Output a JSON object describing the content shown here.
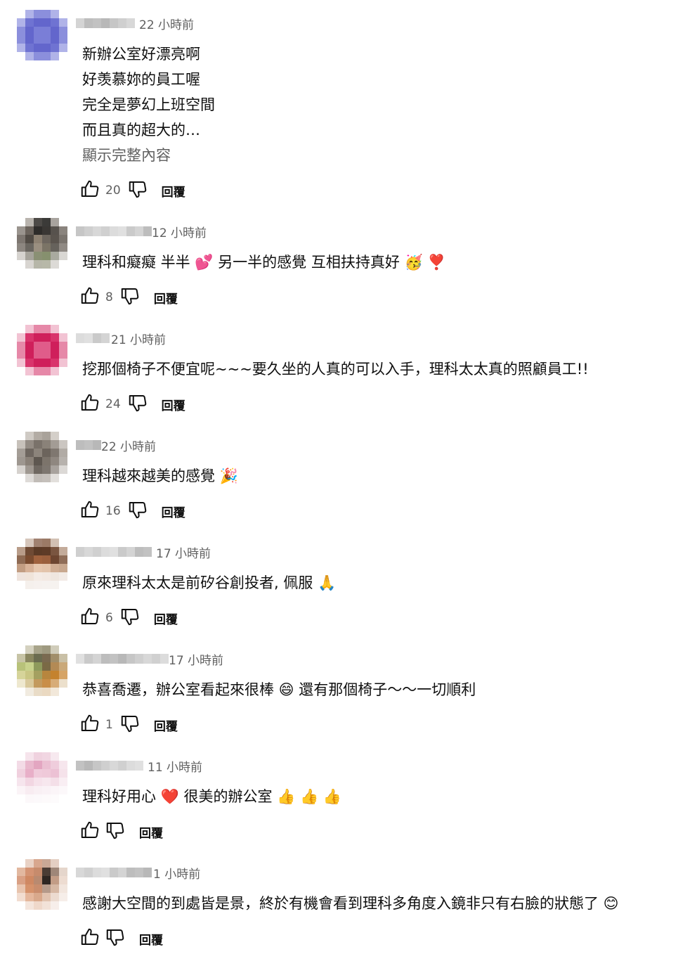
{
  "reply_label": "回覆",
  "show_more_label": "顯示完整內容",
  "comments": [
    {
      "time": "22 小時前",
      "lines": [
        "新辦公室好漂亮啊",
        "好羡慕妳的員工喔",
        "完全是夢幻上班空間",
        "而且真的超大的…"
      ],
      "likes": "20",
      "avatar_palette": [
        "#ffffff",
        "#b0b3e8",
        "#8b8fdc",
        "#8b8fdc",
        "#b0b3e8",
        "#ffffff",
        "#b0b3e8",
        "#6f73d2",
        "#6366cc",
        "#6366cc",
        "#6f73d2",
        "#b0b3e8",
        "#8b8fdc",
        "#6366cc",
        "#7a7ed7",
        "#7a7ed7",
        "#6366cc",
        "#8b8fdc",
        "#8b8fdc",
        "#6366cc",
        "#7a7ed7",
        "#7a7ed7",
        "#6366cc",
        "#8b8fdc",
        "#b0b3e8",
        "#6f73d2",
        "#6366cc",
        "#6366cc",
        "#6f73d2",
        "#b0b3e8",
        "#ffffff",
        "#b0b3e8",
        "#8b8fdc",
        "#8b8fdc",
        "#b0b3e8",
        "#ffffff"
      ]
    },
    {
      "time": "12 小時前",
      "lines": [
        "理科和癡癡 半半 💕 另一半的感覺 互相扶持真好 🥳 ❣️"
      ],
      "likes": "8",
      "avatar_palette": [
        "#ffffff",
        "#b9b4ae",
        "#4d4a47",
        "#3b3a38",
        "#a8a39e",
        "#ffffff",
        "#9a948e",
        "#6b635c",
        "#2e2c2a",
        "#3a3734",
        "#57524d",
        "#8a847e",
        "#7d7670",
        "#514b45",
        "#8d8172",
        "#6d665e",
        "#5a544e",
        "#7a746e",
        "#8c8680",
        "#6a6660",
        "#9a8f80",
        "#7b7466",
        "#66625c",
        "#908a84",
        "#d6d3cf",
        "#a6a39b",
        "#8a9074",
        "#86906e",
        "#a9aa9f",
        "#d9d7d3",
        "#ffffff",
        "#d8d5d1",
        "#b6b6a8",
        "#b7b8a8",
        "#dcdad6",
        "#ffffff"
      ]
    },
    {
      "time": "21 小時前",
      "lines": [
        "挖那個椅子不便宜呢~~~要久坐的人真的可以入手，理科太太真的照顧員工!!"
      ],
      "likes": "24",
      "avatar_palette": [
        "#ffffff",
        "#f2c3d3",
        "#e688a8",
        "#e688a8",
        "#f2c3d3",
        "#ffffff",
        "#f2c3d3",
        "#d9346c",
        "#cf1f5b",
        "#cf1f5b",
        "#d9346c",
        "#f2c3d3",
        "#e688a8",
        "#cf1f5b",
        "#e05c8a",
        "#e05c8a",
        "#cf1f5b",
        "#e688a8",
        "#e688a8",
        "#cf1f5b",
        "#e05c8a",
        "#e05c8a",
        "#cf1f5b",
        "#e688a8",
        "#f2c3d3",
        "#d9346c",
        "#cf1f5b",
        "#cf1f5b",
        "#d9346c",
        "#f2c3d3",
        "#ffffff",
        "#f2c3d3",
        "#e688a8",
        "#e688a8",
        "#f2c3d3",
        "#ffffff"
      ]
    },
    {
      "time": "22 小時前",
      "lines": [
        "理科越來越美的感覺 🎉"
      ],
      "likes": "16",
      "avatar_palette": [
        "#ffffff",
        "#cfcac4",
        "#b3aca4",
        "#a9a29a",
        "#d4cfc9",
        "#ffffff",
        "#c7c1ba",
        "#948c84",
        "#7a726a",
        "#8a8279",
        "#a39c95",
        "#cbc6c1",
        "#a49d96",
        "#6e665f",
        "#8c847b",
        "#6c645c",
        "#7f7770",
        "#b1aba5",
        "#9e9790",
        "#8a8178",
        "#5e5750",
        "#7c746b",
        "#8f8780",
        "#b7b2ad",
        "#d6d2ce",
        "#9f9891",
        "#6f6861",
        "#7d766f",
        "#a8a29d",
        "#dcd9d6",
        "#ffffff",
        "#dedbd8",
        "#c1bcb7",
        "#c5c0bb",
        "#e2dfdc",
        "#ffffff"
      ]
    },
    {
      "time": "17 小時前",
      "lines": [
        "原來理科太太是前矽谷創投者, 佩服 🙏"
      ],
      "likes": "6",
      "avatar_palette": [
        "#ffffff",
        "#d6c6bb",
        "#a08170",
        "#9b7a66",
        "#d2c0b3",
        "#ffffff",
        "#b89c89",
        "#6f4a34",
        "#5b3a26",
        "#5e3b27",
        "#7a5540",
        "#c3ab9a",
        "#8e6a53",
        "#7a4b2f",
        "#a0623e",
        "#9a5f3d",
        "#6d4530",
        "#8f6d58",
        "#c29d82",
        "#d8b399",
        "#e6c7ae",
        "#e3c4ab",
        "#d0ad93",
        "#c8a88f",
        "#efe4dd",
        "#f0e4da",
        "#f4ebe5",
        "#f3e9e2",
        "#efe6df",
        "#f2ebe6",
        "#ffffff",
        "#f5f0ec",
        "#f6f1ee",
        "#f6f2ef",
        "#f6f2ef",
        "#ffffff"
      ]
    },
    {
      "time": "17 小時前",
      "lines": [
        "恭喜喬遷，辦公室看起來很棒 😄 還有那個椅子～～一切順利"
      ],
      "likes": "1",
      "avatar_palette": [
        "#ffffff",
        "#d4d1bf",
        "#a8a48a",
        "#9f9a80",
        "#d0ccba",
        "#ffffff",
        "#c7c4a6",
        "#8a8760",
        "#6b6c50",
        "#7a6a50",
        "#a18e6a",
        "#c9c0a6",
        "#b8c27a",
        "#c8d28c",
        "#8e9a5c",
        "#7a6a45",
        "#b38a55",
        "#caa97a",
        "#d6d49a",
        "#c9c684",
        "#a4a060",
        "#b7863e",
        "#c4822e",
        "#d6a466",
        "#eee8cf",
        "#d9c99c",
        "#c39a5e",
        "#c98e48",
        "#d7ac78",
        "#ece0cc",
        "#ffffff",
        "#f1ebe0",
        "#e9dcc7",
        "#ead9c1",
        "#f2e8da",
        "#ffffff"
      ]
    },
    {
      "time": "11 小時前",
      "lines": [
        "理科好用心 ❤️ 很美的辦公室 👍 👍 👍"
      ],
      "likes": "",
      "avatar_palette": [
        "#ffffff",
        "#f6e4ec",
        "#f0d2df",
        "#f1d6e2",
        "#f7e9ef",
        "#ffffff",
        "#f3dbe6",
        "#e9b8cd",
        "#e3a6c1",
        "#ebbfd2",
        "#efcddc",
        "#f6e6ed",
        "#f0d0de",
        "#e8afc8",
        "#f0cbdb",
        "#efc9d9",
        "#ecc1d4",
        "#f5e2ea",
        "#f6e5ed",
        "#f2d6e2",
        "#f6e2eb",
        "#f7e7ee",
        "#f4dfe8",
        "#f9eef3",
        "#fbf4f7",
        "#f8ecf1",
        "#f9f0f4",
        "#faf2f6",
        "#fbf5f8",
        "#fcf8fa",
        "#ffffff",
        "#fcf8fa",
        "#fcf9fb",
        "#fdfafb",
        "#fdfbfc",
        "#ffffff"
      ]
    },
    {
      "time": "1 小時前",
      "lines": [
        "感謝大空間的到處皆是景，終於有機會看到理科多角度入鏡非只有右臉的狀態了 😊"
      ],
      "likes": "",
      "avatar_palette": [
        "#ffffff",
        "#e9d2c5",
        "#d8a78e",
        "#c9a896",
        "#e4cfc3",
        "#ffffff",
        "#e2b8a0",
        "#d49373",
        "#c78b6c",
        "#4a3c34",
        "#9e8678",
        "#e5d6cc",
        "#d9a084",
        "#cf8862",
        "#b98a70",
        "#2e2622",
        "#c29c86",
        "#eddcd1",
        "#e8c4ae",
        "#d6926b",
        "#c98d6d",
        "#b59a8a",
        "#d6b8a4",
        "#f2e6de",
        "#f2ddd0",
        "#e5b79c",
        "#d9a98c",
        "#e1c3b0",
        "#ecdbd0",
        "#f6eee9",
        "#ffffff",
        "#f4e5dc",
        "#efd8ca",
        "#f2e2d8",
        "#f7eeea",
        "#ffffff"
      ]
    }
  ]
}
